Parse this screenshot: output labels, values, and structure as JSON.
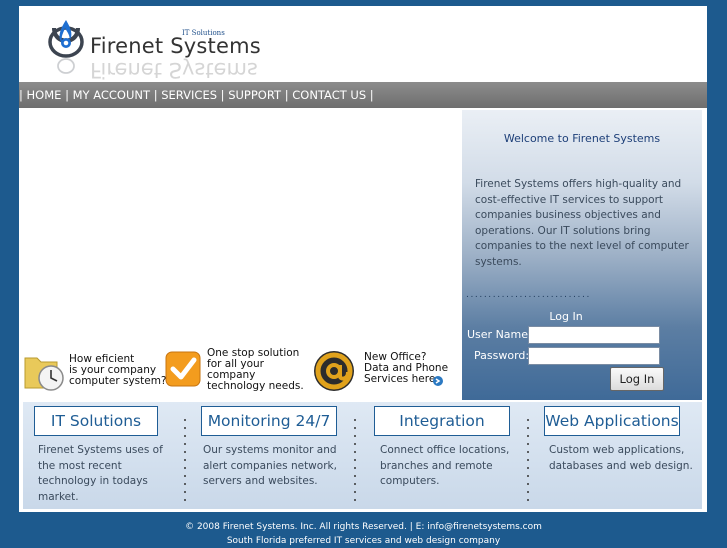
{
  "header": {
    "title": "Firenet Systems",
    "tagline": "IT Solutions"
  },
  "nav": {
    "items": [
      {
        "label": "HOME"
      },
      {
        "label": "MY ACCOUNT"
      },
      {
        "label": "SERVICES"
      },
      {
        "label": "SUPPORT"
      },
      {
        "label": "CONTACT US"
      }
    ]
  },
  "promos": [
    {
      "text": "How eficient\nis your company\ncomputer system?",
      "icon": "clock-folder-icon"
    },
    {
      "text": "One stop solution\nfor all your\ncompany\ntechnology needs.",
      "icon": "checkmark-icon"
    },
    {
      "text": "New Office?\nData and Phone\nServices here",
      "icon": "at-sign-icon"
    }
  ],
  "welcome": {
    "title": "Welcome to Firenet Systems",
    "body": "Firenet Systems offers high-quality and cost-effective IT services to support companies business objectives and operations. Our IT solutions bring companies to the next level of computer systems.",
    "dots": "............................"
  },
  "login": {
    "title": "Log In",
    "username_label": "User Name:",
    "password_label": "Password:",
    "username_value": "",
    "password_value": "",
    "button_label": "Log In"
  },
  "features": [
    {
      "title": "IT Solutions",
      "description": "Firenet Systems uses of the most recent technology in todays market."
    },
    {
      "title": "Monitoring 24/7",
      "description": "Our systems monitor and alert companies network, servers and websites."
    },
    {
      "title": "Integration",
      "description": "Connect office locations, branches and remote computers."
    },
    {
      "title": "Web Applications",
      "description": "Custom web applications, databases and web design."
    }
  ],
  "footer": {
    "line1": "© 2008 Firenet Systems. Inc. All rights Reserved.  |  E: info@firenetsystems.com",
    "line2": "South Florida preferred IT services and web design company"
  },
  "colors": {
    "background": "#1d5a8e",
    "accent": "#1f5d95",
    "nav": "#7d7d7d"
  }
}
